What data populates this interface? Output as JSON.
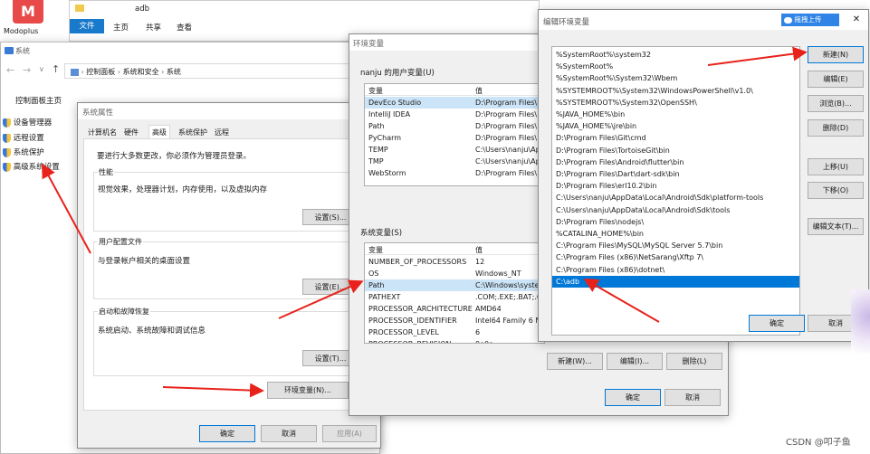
{
  "taskbar": {
    "app_name": "Modoplus"
  },
  "explorer": {
    "title": "adb",
    "ribbon_tabs": [
      "文件",
      "主页",
      "共享",
      "查看"
    ]
  },
  "system_window": {
    "title": "系统",
    "breadcrumb": [
      "控制面板",
      "系统和安全",
      "系统"
    ],
    "sidebar_title": "控制面板主页",
    "sidebar_items": [
      "设备管理器",
      "远程设置",
      "系统保护",
      "高级系统设置"
    ]
  },
  "sysprops": {
    "title": "系统属性",
    "tabs": [
      "计算机名",
      "硬件",
      "高级",
      "系统保护",
      "远程"
    ],
    "active_tab": 2,
    "admin_note": "要进行大多数更改，你必须作为管理员登录。",
    "perf": {
      "label": "性能",
      "desc": "视觉效果，处理器计划，内存使用，以及虚拟内存",
      "btn": "设置(S)..."
    },
    "profile": {
      "label": "用户配置文件",
      "desc": "与登录帐户相关的桌面设置",
      "btn": "设置(E)..."
    },
    "startup": {
      "label": "启动和故障恢复",
      "desc": "系统启动、系统故障和调试信息",
      "btn": "设置(T)..."
    },
    "env_btn": "环境变量(N)...",
    "ok": "确定",
    "cancel": "取消",
    "apply": "应用(A)"
  },
  "envvars": {
    "title": "环境变量",
    "user_label": "nanju 的用户变量(U)",
    "col_var": "变量",
    "col_val": "值",
    "user_vars": [
      {
        "name": "DevEco Studio",
        "value": "D:\\Program Files\\"
      },
      {
        "name": "IntelliJ IDEA",
        "value": "D:\\Program Files\\"
      },
      {
        "name": "Path",
        "value": "D:\\Program Files\\"
      },
      {
        "name": "PyCharm",
        "value": "D:\\Program Files\\"
      },
      {
        "name": "TEMP",
        "value": "C:\\Users\\nanju\\Ap"
      },
      {
        "name": "TMP",
        "value": "C:\\Users\\nanju\\Ap"
      },
      {
        "name": "WebStorm",
        "value": "D:\\Program Files\\"
      }
    ],
    "sys_label": "系统变量(S)",
    "sys_vars": [
      {
        "name": "NUMBER_OF_PROCESSORS",
        "value": "12"
      },
      {
        "name": "OS",
        "value": "Windows_NT"
      },
      {
        "name": "Path",
        "value": "C:\\Windows\\system"
      },
      {
        "name": "PATHEXT",
        "value": ".COM;.EXE;.BAT;.C"
      },
      {
        "name": "PROCESSOR_ARCHITECTURE",
        "value": "AMD64"
      },
      {
        "name": "PROCESSOR_IDENTIFIER",
        "value": "Intel64 Family 6 M"
      },
      {
        "name": "PROCESSOR_LEVEL",
        "value": "6"
      },
      {
        "name": "PROCESSOR_REVISION",
        "value": "9e0a"
      }
    ],
    "new_btn": "新建(W)...",
    "edit_btn": "编辑(I)...",
    "del_btn": "删除(L)",
    "ok": "确定",
    "cancel": "取消"
  },
  "editenv": {
    "title": "编辑环境变量",
    "upload_btn": "拖拽上传",
    "paths": [
      "%SystemRoot%\\system32",
      "%SystemRoot%",
      "%SystemRoot%\\System32\\Wbem",
      "%SYSTEMROOT%\\System32\\WindowsPowerShell\\v1.0\\",
      "%SYSTEMROOT%\\System32\\OpenSSH\\",
      "%JAVA_HOME%\\bin",
      "%JAVA_HOME%\\jre\\bin",
      "D:\\Program Files\\Git\\cmd",
      "D:\\Program Files\\TortoiseGit\\bin",
      "D:\\Program Files\\Android\\flutter\\bin",
      "D:\\Program Files\\Dart\\dart-sdk\\bin",
      "D:\\Program Files\\erl10.2\\bin",
      "C:\\Users\\nanju\\AppData\\Local\\Android\\Sdk\\platform-tools",
      "C:\\Users\\nanju\\AppData\\Local\\Android\\Sdk\\tools",
      "D:\\Program Files\\nodejs\\",
      "%CATALINA_HOME%\\bin",
      "C:\\Program Files\\MySQL\\MySQL Server 5.7\\bin",
      "C:\\Program Files (x86)\\NetSarang\\Xftp 7\\",
      "C:\\Program Files (x86)\\dotnet\\",
      "C:\\adb"
    ],
    "selected": 19,
    "new_btn": "新建(N)",
    "edit_btn": "编辑(E)",
    "browse_btn": "浏览(B)...",
    "del_btn": "删除(D)",
    "up_btn": "上移(U)",
    "down_btn": "下移(O)",
    "edit_text_btn": "编辑文本(T)...",
    "ok": "确定",
    "cancel": "取消"
  },
  "watermark": "CSDN @叩子鱼",
  "accent": "#0078d7",
  "arrow_color": "#e8221b"
}
